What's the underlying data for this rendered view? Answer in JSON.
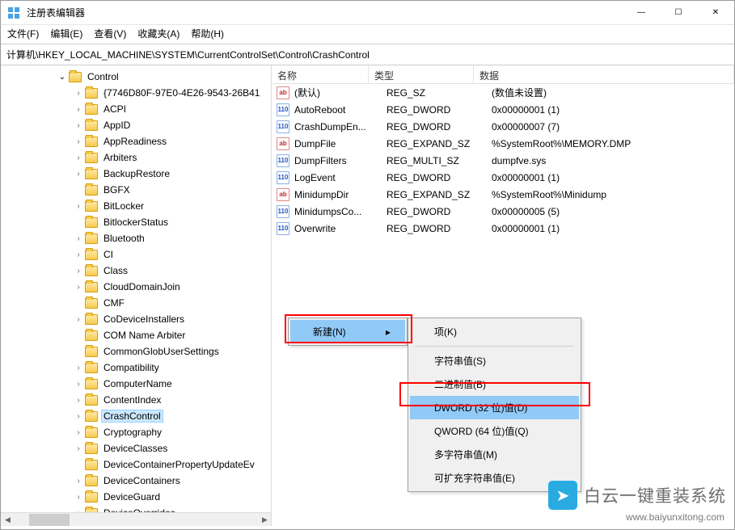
{
  "window": {
    "title": "注册表编辑器",
    "min_icon": "—",
    "max_icon": "☐",
    "close_icon": "✕"
  },
  "menu": {
    "file": "文件(F)",
    "edit": "编辑(E)",
    "view": "查看(V)",
    "fav": "收藏夹(A)",
    "help": "帮助(H)"
  },
  "path": "计算机\\HKEY_LOCAL_MACHINE\\SYSTEM\\CurrentControlSet\\Control\\CrashControl",
  "tree": {
    "items": [
      {
        "indent": 70,
        "exp": "open",
        "label": "Control",
        "sel": false
      },
      {
        "indent": 90,
        "exp": "closed",
        "label": "{7746D80F-97E0-4E26-9543-26B41",
        "sel": false
      },
      {
        "indent": 90,
        "exp": "closed",
        "label": "ACPI",
        "sel": false
      },
      {
        "indent": 90,
        "exp": "closed",
        "label": "AppID",
        "sel": false
      },
      {
        "indent": 90,
        "exp": "closed",
        "label": "AppReadiness",
        "sel": false
      },
      {
        "indent": 90,
        "exp": "closed",
        "label": "Arbiters",
        "sel": false
      },
      {
        "indent": 90,
        "exp": "closed",
        "label": "BackupRestore",
        "sel": false
      },
      {
        "indent": 90,
        "exp": "none",
        "label": "BGFX",
        "sel": false
      },
      {
        "indent": 90,
        "exp": "closed",
        "label": "BitLocker",
        "sel": false
      },
      {
        "indent": 90,
        "exp": "none",
        "label": "BitlockerStatus",
        "sel": false
      },
      {
        "indent": 90,
        "exp": "closed",
        "label": "Bluetooth",
        "sel": false
      },
      {
        "indent": 90,
        "exp": "closed",
        "label": "CI",
        "sel": false
      },
      {
        "indent": 90,
        "exp": "closed",
        "label": "Class",
        "sel": false
      },
      {
        "indent": 90,
        "exp": "closed",
        "label": "CloudDomainJoin",
        "sel": false
      },
      {
        "indent": 90,
        "exp": "none",
        "label": "CMF",
        "sel": false
      },
      {
        "indent": 90,
        "exp": "closed",
        "label": "CoDeviceInstallers",
        "sel": false
      },
      {
        "indent": 90,
        "exp": "none",
        "label": "COM Name Arbiter",
        "sel": false
      },
      {
        "indent": 90,
        "exp": "none",
        "label": "CommonGlobUserSettings",
        "sel": false
      },
      {
        "indent": 90,
        "exp": "closed",
        "label": "Compatibility",
        "sel": false
      },
      {
        "indent": 90,
        "exp": "closed",
        "label": "ComputerName",
        "sel": false
      },
      {
        "indent": 90,
        "exp": "closed",
        "label": "ContentIndex",
        "sel": false
      },
      {
        "indent": 90,
        "exp": "closed",
        "label": "CrashControl",
        "sel": true
      },
      {
        "indent": 90,
        "exp": "closed",
        "label": "Cryptography",
        "sel": false
      },
      {
        "indent": 90,
        "exp": "closed",
        "label": "DeviceClasses",
        "sel": false
      },
      {
        "indent": 90,
        "exp": "none",
        "label": "DeviceContainerPropertyUpdateEv",
        "sel": false
      },
      {
        "indent": 90,
        "exp": "closed",
        "label": "DeviceContainers",
        "sel": false
      },
      {
        "indent": 90,
        "exp": "closed",
        "label": "DeviceGuard",
        "sel": false
      },
      {
        "indent": 90,
        "exp": "closed",
        "label": "DeviceOverrides",
        "sel": false
      }
    ]
  },
  "columns": {
    "name": "名称",
    "type": "类型",
    "data": "数据"
  },
  "values": [
    {
      "icon": "str",
      "name": "(默认)",
      "type": "REG_SZ",
      "data": "(数值未设置)"
    },
    {
      "icon": "bin",
      "name": "AutoReboot",
      "type": "REG_DWORD",
      "data": "0x00000001 (1)"
    },
    {
      "icon": "bin",
      "name": "CrashDumpEn...",
      "type": "REG_DWORD",
      "data": "0x00000007 (7)"
    },
    {
      "icon": "str",
      "name": "DumpFile",
      "type": "REG_EXPAND_SZ",
      "data": "%SystemRoot%\\MEMORY.DMP"
    },
    {
      "icon": "bin",
      "name": "DumpFilters",
      "type": "REG_MULTI_SZ",
      "data": "dumpfve.sys"
    },
    {
      "icon": "bin",
      "name": "LogEvent",
      "type": "REG_DWORD",
      "data": "0x00000001 (1)"
    },
    {
      "icon": "str",
      "name": "MinidumpDir",
      "type": "REG_EXPAND_SZ",
      "data": "%SystemRoot%\\Minidump"
    },
    {
      "icon": "bin",
      "name": "MinidumpsCo...",
      "type": "REG_DWORD",
      "data": "0x00000005 (5)"
    },
    {
      "icon": "bin",
      "name": "Overwrite",
      "type": "REG_DWORD",
      "data": "0x00000001 (1)"
    }
  ],
  "ctx_main": {
    "new": "新建(N)",
    "arrow": "▸"
  },
  "ctx_sub": {
    "key": "项(K)",
    "string": "字符串值(S)",
    "binary": "二进制值(B)",
    "dword": "DWORD (32 位)值(D)",
    "qword": "QWORD (64 位)值(Q)",
    "multi": "多字符串值(M)",
    "expand": "可扩充字符串值(E)"
  },
  "watermark": {
    "text": "白云一键重装系统",
    "sub": "www.baiyunxitong.com"
  }
}
